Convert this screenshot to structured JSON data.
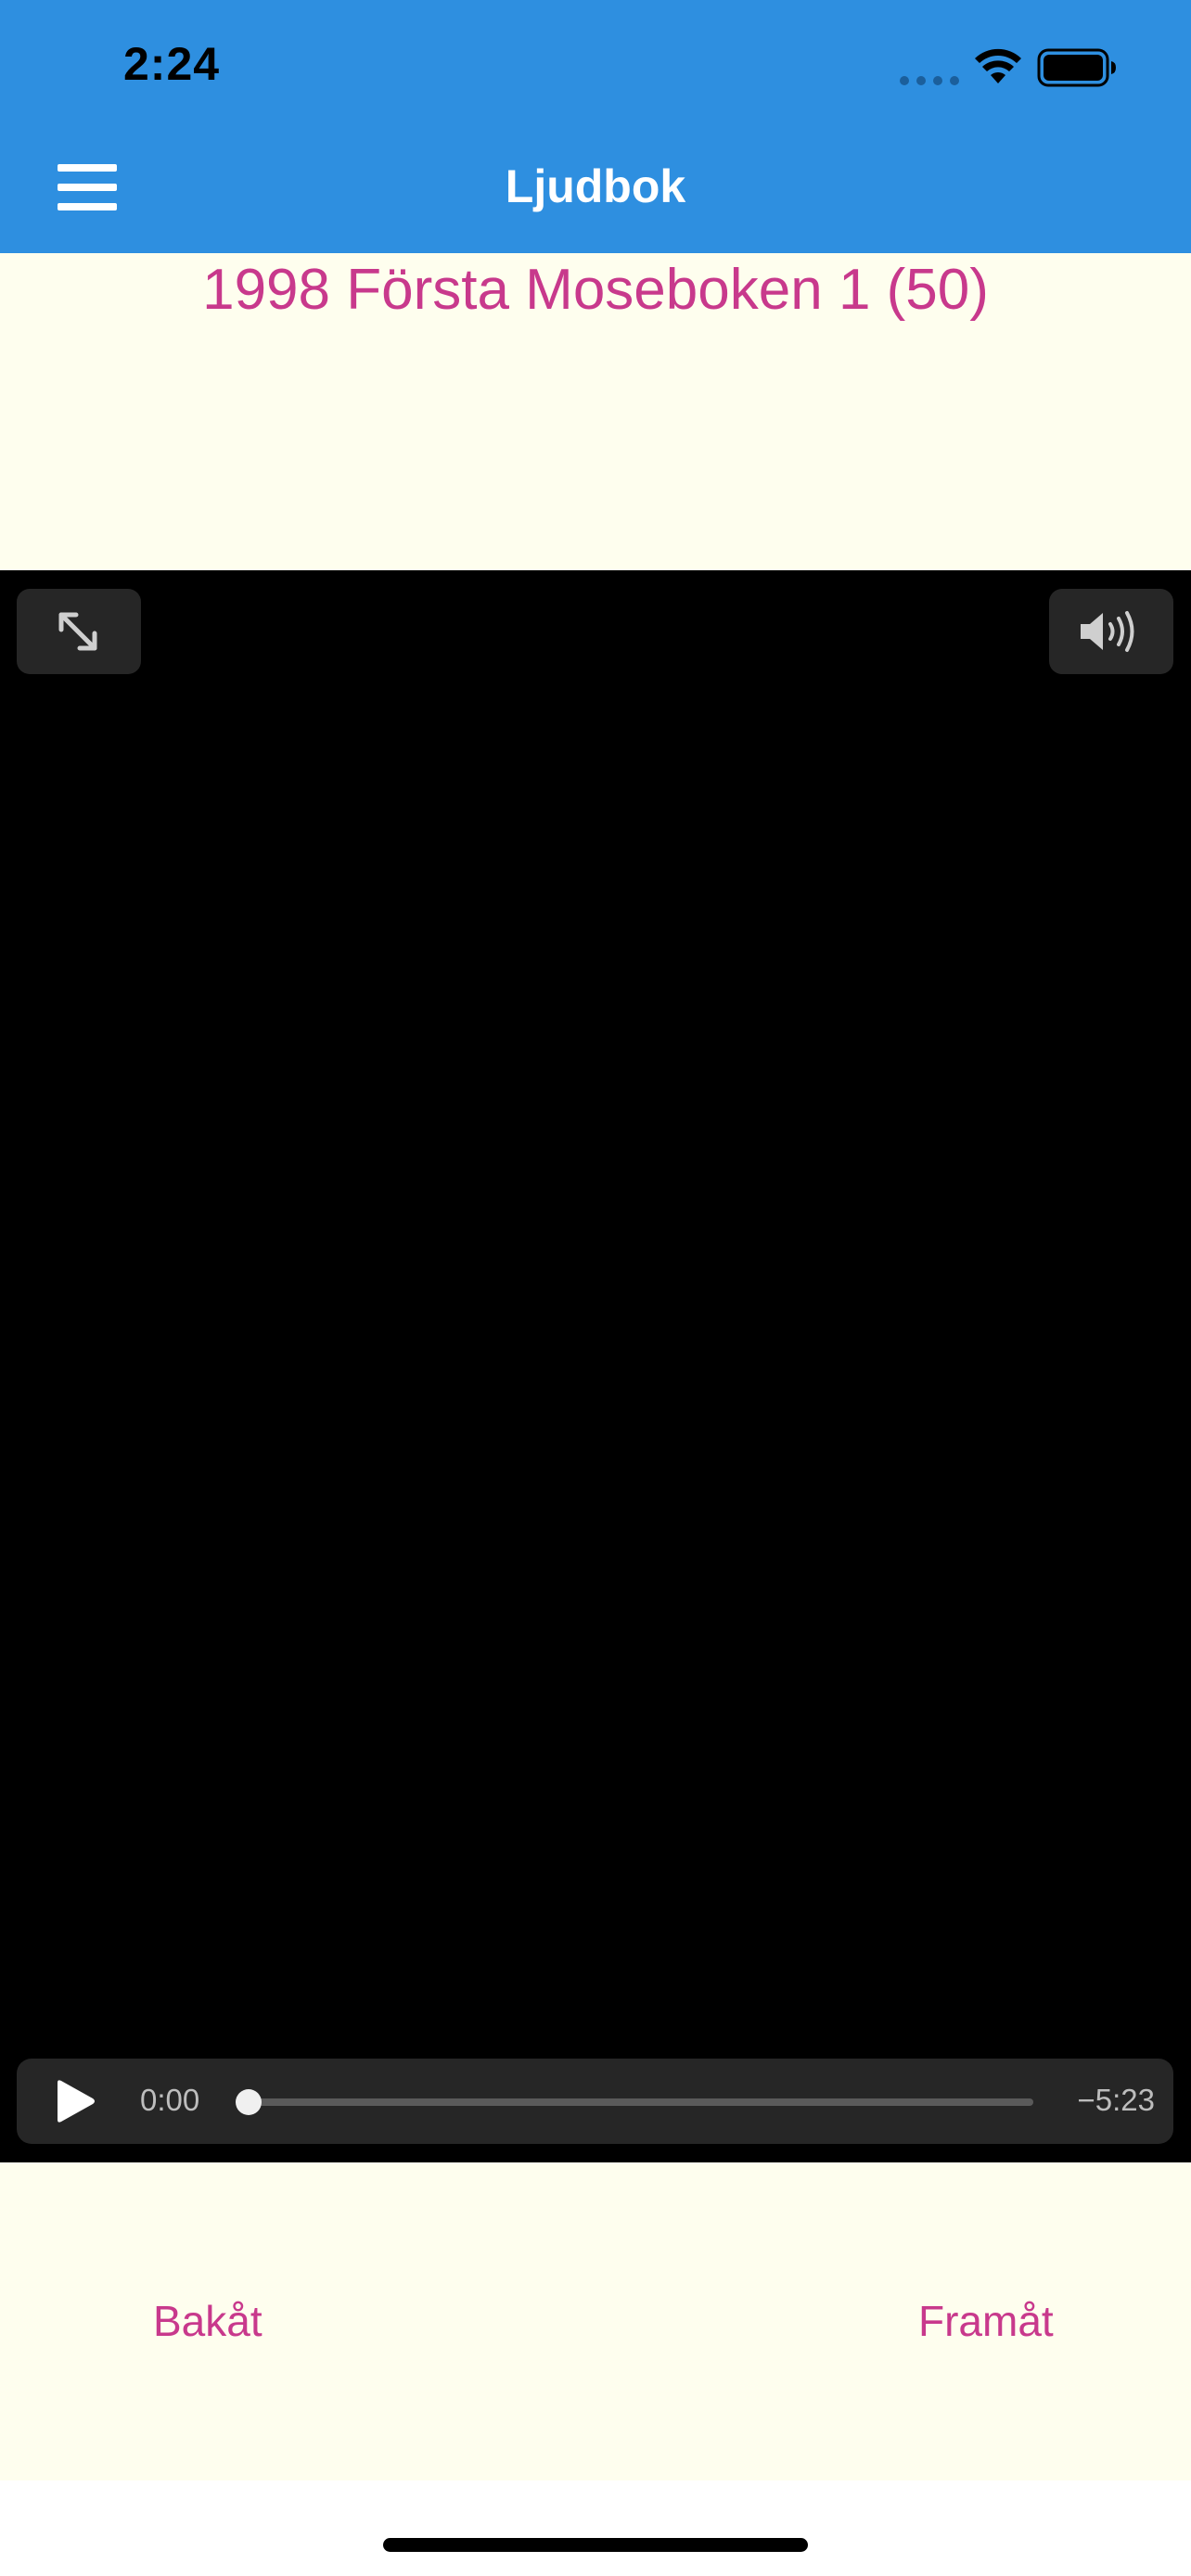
{
  "status_bar": {
    "time": "2:24",
    "signal_icon": "cellular-signal-dots",
    "wifi_icon": "wifi-icon",
    "battery_icon": "battery-full-icon"
  },
  "nav_bar": {
    "menu_icon": "hamburger-menu-icon",
    "title": "Ljudbok"
  },
  "track": {
    "title": "1998 Första Moseboken 1 (50)"
  },
  "player": {
    "fullscreen_icon": "expand-arrows-icon",
    "volume_icon": "speaker-volume-icon",
    "play_icon": "play-icon",
    "elapsed": "0:00",
    "remaining": "−5:23",
    "progress_fraction": 0
  },
  "navigation": {
    "back_label": "Bakåt",
    "forward_label": "Framåt"
  },
  "colors": {
    "header": "#2e8fe0",
    "background": "#fefeee",
    "accent": "#c8398c",
    "player_bg": "#000000"
  }
}
